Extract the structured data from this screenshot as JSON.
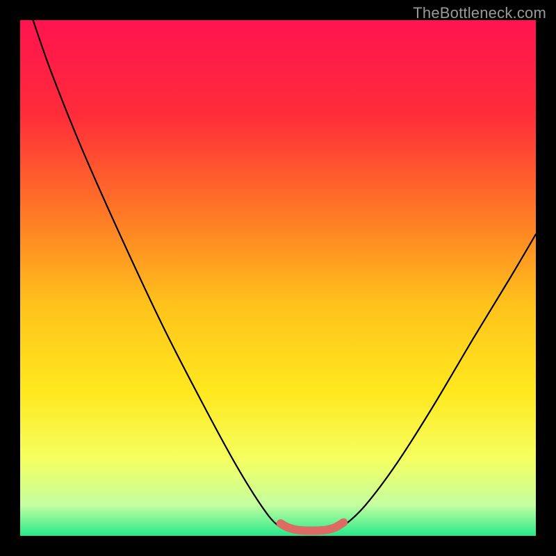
{
  "watermark": {
    "text": "TheBottleneck.com"
  },
  "chart_data": {
    "type": "line",
    "title": "",
    "xlabel": "",
    "ylabel": "",
    "xlim": [
      0,
      100
    ],
    "ylim": [
      0,
      100
    ],
    "background_gradient": {
      "stops": [
        {
          "offset": 0,
          "color": "#ff1450"
        },
        {
          "offset": 18,
          "color": "#ff2b3a"
        },
        {
          "offset": 38,
          "color": "#ff7a26"
        },
        {
          "offset": 55,
          "color": "#ffc21c"
        },
        {
          "offset": 72,
          "color": "#ffe81e"
        },
        {
          "offset": 85,
          "color": "#f6ff60"
        },
        {
          "offset": 94,
          "color": "#c4ffa0"
        },
        {
          "offset": 100,
          "color": "#26e98c"
        }
      ]
    },
    "series": [
      {
        "name": "bottleneck-curve",
        "color": "#000000",
        "width": 2.2,
        "points": [
          {
            "x": 2.5,
            "y": 100.0
          },
          {
            "x": 6.0,
            "y": 90.0
          },
          {
            "x": 12.0,
            "y": 75.0
          },
          {
            "x": 20.0,
            "y": 57.0
          },
          {
            "x": 28.0,
            "y": 40.0
          },
          {
            "x": 36.0,
            "y": 24.5
          },
          {
            "x": 42.0,
            "y": 13.5
          },
          {
            "x": 47.0,
            "y": 5.5
          },
          {
            "x": 50.0,
            "y": 2.0
          },
          {
            "x": 53.0,
            "y": 0.8
          },
          {
            "x": 56.5,
            "y": 0.6
          },
          {
            "x": 60.0,
            "y": 0.8
          },
          {
            "x": 63.0,
            "y": 2.2
          },
          {
            "x": 67.0,
            "y": 6.0
          },
          {
            "x": 73.0,
            "y": 14.0
          },
          {
            "x": 80.0,
            "y": 25.0
          },
          {
            "x": 88.0,
            "y": 38.5
          },
          {
            "x": 95.0,
            "y": 50.0
          },
          {
            "x": 100.0,
            "y": 58.5
          }
        ]
      },
      {
        "name": "optimal-band",
        "color": "#dd6a63",
        "width": 12,
        "linecap": "round",
        "points": [
          {
            "x": 50.5,
            "y": 2.4
          },
          {
            "x": 52.0,
            "y": 1.6
          },
          {
            "x": 54.0,
            "y": 1.1
          },
          {
            "x": 56.5,
            "y": 1.0
          },
          {
            "x": 59.0,
            "y": 1.1
          },
          {
            "x": 61.0,
            "y": 1.6
          },
          {
            "x": 62.7,
            "y": 2.6
          }
        ]
      }
    ]
  }
}
